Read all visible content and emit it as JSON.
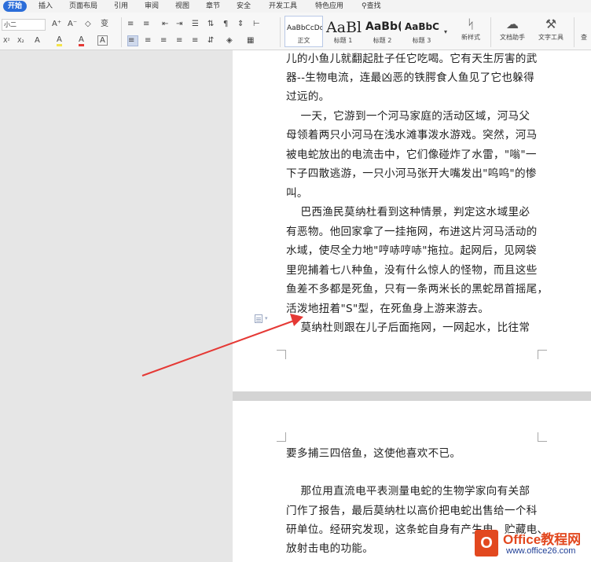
{
  "tabs": [
    {
      "label": "开始",
      "active": true
    },
    {
      "label": "插入"
    },
    {
      "label": "页面布局"
    },
    {
      "label": "引用"
    },
    {
      "label": "审阅"
    },
    {
      "label": "视图"
    },
    {
      "label": "章节"
    },
    {
      "label": "安全"
    },
    {
      "label": "开发工具"
    },
    {
      "label": "特色应用"
    },
    {
      "label": "查找",
      "icon": "search-icon"
    }
  ],
  "ribbon": {
    "font_size_value": "小二",
    "grow_font": "A⁺",
    "shrink_font": "A⁻",
    "clear_format": "◇",
    "phonetic": "变",
    "superscript": "X²",
    "subscript": "X₂",
    "text_effect": "A",
    "highlight": "A",
    "font_color": "A",
    "char_border": "A",
    "styles": [
      {
        "preview": "AaBbCcDd",
        "label": "正文"
      },
      {
        "preview": "AaBl",
        "label": "标题 1"
      },
      {
        "preview": "AaBb(",
        "label": "标题 2"
      },
      {
        "preview": "AaBbC",
        "label": "标题 3"
      }
    ],
    "new_style": "新样式",
    "doc_assistant": "文档助手",
    "text_tools": "文字工具",
    "find_label": "查"
  },
  "page1": {
    "lines": [
      "儿的小鱼儿就翻起肚子任它吃喝。它有天生厉害的武",
      "器--生物电流，连最凶恶的铁腭食人鱼见了它也躲得",
      "过远的。",
      "    一天，它游到一个河马家庭的活动区域，河马父",
      "母领着两只小河马在浅水滩事泼水游戏。突然，河马",
      "被电蛇放出的电流击中，它们像碰炸了水雷，\"嗡\"一",
      "下子四散逃游，一只小河马张开大嘴发出\"呜呜\"的惨",
      "叫。",
      "    巴西渔民莫纳杜看到这种情景，判定这水域里必",
      "有恶物。他回家拿了一挂拖网，布进这片河马活动的",
      "水域，使尽全力地\"哼哧哼哧\"拖拉。起网后，见网袋",
      "里兜捕着七八种鱼，没有什么惊人的怪物，而且这些",
      "鱼差不多都是死鱼，只有一条两米长的黑蛇昂首摇尾，",
      "活泼地扭着\"S\"型，在死鱼身上游来游去。",
      "    莫纳杜则跟在儿子后面拖网，一网起水，比往常"
    ]
  },
  "page2": {
    "lines": [
      "要多捕三四倍鱼，这使他喜欢不已。",
      "",
      "    那位用直流电平表测量电蛇的生物学家向有关部",
      "门作了报告，最后莫纳杜以高价把电蛇出售给一个科",
      "研单位。经研究发现，这条蛇自身有产生电、贮藏电、",
      "放射击电的功能。"
    ]
  },
  "annotation": {
    "color": "#e53935"
  },
  "watermark": {
    "logo_letter": "O",
    "title": "Office教程网",
    "url": "www.office26.com"
  }
}
